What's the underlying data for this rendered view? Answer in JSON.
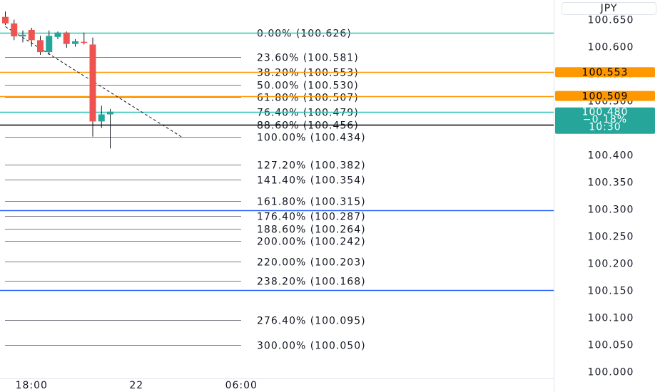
{
  "chart_data": {
    "type": "candlestick",
    "currency": "JPY",
    "y_axis": {
      "min": 100.0,
      "max": 100.65,
      "ticks": [
        "100.650",
        "100.600",
        "100.550",
        "100.500",
        "100.450",
        "100.400",
        "100.350",
        "100.300",
        "100.250",
        "100.200",
        "100.150",
        "100.100",
        "100.050",
        "100.000"
      ]
    },
    "x_axis": {
      "ticks": [
        {
          "label": "18:00",
          "bar": 3
        },
        {
          "label": "22",
          "bar": 15
        },
        {
          "label": "06:00",
          "bar": 27
        }
      ]
    },
    "candles": [
      {
        "o": 100.655,
        "h": 100.665,
        "l": 100.64,
        "c": 100.643
      },
      {
        "o": 100.643,
        "h": 100.65,
        "l": 100.612,
        "c": 100.619
      },
      {
        "o": 100.619,
        "h": 100.63,
        "l": 100.608,
        "c": 100.622
      },
      {
        "o": 100.631,
        "h": 100.635,
        "l": 100.6,
        "c": 100.612
      },
      {
        "o": 100.612,
        "h": 100.62,
        "l": 100.585,
        "c": 100.59
      },
      {
        "o": 100.59,
        "h": 100.63,
        "l": 100.585,
        "c": 100.62
      },
      {
        "o": 100.618,
        "h": 100.628,
        "l": 100.614,
        "c": 100.626
      },
      {
        "o": 100.626,
        "h": 100.628,
        "l": 100.598,
        "c": 100.605
      },
      {
        "o": 100.605,
        "h": 100.614,
        "l": 100.6,
        "c": 100.61
      },
      {
        "o": 100.609,
        "h": 100.626,
        "l": 100.604,
        "c": 100.607
      },
      {
        "o": 100.604,
        "h": 100.617,
        "l": 100.434,
        "c": 100.462
      },
      {
        "o": 100.462,
        "h": 100.491,
        "l": 100.45,
        "c": 100.475
      },
      {
        "o": 100.475,
        "h": 100.485,
        "l": 100.412,
        "c": 100.48
      }
    ],
    "fibonacci": {
      "levels": [
        {
          "label": "0.00% (100.626)",
          "value": 100.626,
          "color": "#2ec4b6"
        },
        {
          "label": "23.60% (100.581)",
          "value": 100.581,
          "color": "#787b86"
        },
        {
          "label": "38.20% (100.553)",
          "value": 100.553,
          "color": "#787b86"
        },
        {
          "label": "50.00% (100.530)",
          "value": 100.53,
          "color": "#787b86"
        },
        {
          "label": "61.80% (100.507)",
          "value": 100.507,
          "color": "#787b86"
        },
        {
          "label": "76.40% (100.479)",
          "value": 100.479,
          "color": "#787b86"
        },
        {
          "label": "88.60% (100.456)",
          "value": 100.456,
          "color": "#787b86"
        },
        {
          "label": "100.00% (100.434)",
          "value": 100.434,
          "color": "#787b86"
        },
        {
          "label": "127.20% (100.382)",
          "value": 100.382,
          "color": "#787b86"
        },
        {
          "label": "141.40% (100.354)",
          "value": 100.354,
          "color": "#787b86"
        },
        {
          "label": "161.80% (100.315)",
          "value": 100.315,
          "color": "#787b86"
        },
        {
          "label": "176.40% (100.287)",
          "value": 100.287,
          "color": "#787b86"
        },
        {
          "label": "188.60% (100.264)",
          "value": 100.264,
          "color": "#787b86"
        },
        {
          "label": "200.00% (100.242)",
          "value": 100.242,
          "color": "#787b86"
        },
        {
          "label": "220.00% (100.203)",
          "value": 100.203,
          "color": "#787b86"
        },
        {
          "label": "238.20% (100.168)",
          "value": 100.168,
          "color": "#787b86"
        },
        {
          "label": "276.40% (100.095)",
          "value": 100.095,
          "color": "#787b86"
        },
        {
          "label": "300.00% (100.050)",
          "value": 100.05,
          "color": "#787b86"
        }
      ]
    },
    "horizontal_lines": [
      {
        "value": 100.626,
        "color": "#2ec4b6"
      },
      {
        "value": 100.553,
        "color": "#ff9800"
      },
      {
        "value": 100.509,
        "color": "#ff9800"
      },
      {
        "value": 100.48,
        "color": "#2ec4b6"
      },
      {
        "value": 100.456,
        "color": "#000000"
      },
      {
        "value": 100.298,
        "color": "#2962ff"
      },
      {
        "value": 100.151,
        "color": "#2962ff"
      }
    ],
    "price_tags": [
      {
        "value": 100.553,
        "lines": [
          "100.553"
        ],
        "bg": "#ff9800",
        "fg": "#000000"
      },
      {
        "value": 100.509,
        "lines": [
          "100.509"
        ],
        "bg": "#ff9800",
        "fg": "#000000"
      },
      {
        "value": 100.48,
        "lines": [
          "100.480",
          "−0.18%",
          "10:30"
        ],
        "bg": "#26a69a",
        "fg": "#ffffff"
      }
    ],
    "trend_line": {
      "from": {
        "bar": 0,
        "value": 100.637
      },
      "to": {
        "bar": 20.3,
        "value": 100.432
      }
    },
    "colors": {
      "up": "#26a69a",
      "down": "#ef5350",
      "wick": "#131722"
    }
  }
}
